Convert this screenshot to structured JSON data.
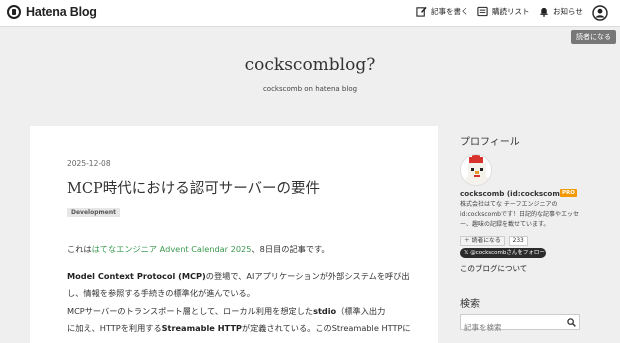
{
  "topbar": {
    "logo": "Hatena Blog",
    "write": "記事を書く",
    "reading_list": "購読リスト",
    "notifications": "お知らせ"
  },
  "reader_button": "読者になる",
  "blog": {
    "title": "cockscomblog?",
    "description": "cockscomb on hatena blog"
  },
  "article": {
    "date": "2025-12-08",
    "title": "MCP時代における認可サーバーの要件",
    "tag": "Development",
    "intro_prefix": "これは",
    "intro_link": "はてなエンジニア Advent Calendar 2025",
    "intro_suffix": "、8日目の記事です。",
    "p2_bold": "Model Context Protocol (MCP)",
    "p2_line1": "の登場で、AIアプリケーションが外部システムを呼び出",
    "p2_line2": "し、情報を参照する手続きの標準化が進んでいる。",
    "p3_a": "MCPサーバーのトランスポート層として、ローカル利用を想定した",
    "p3_b1": "stdio",
    "p3_c": "（標準入出力",
    "p3_d": "に加え、HTTPを利用する",
    "p3_b2": "Streamable HTTP",
    "p3_e": "が定義されている。このStreamable HTTPに"
  },
  "sidebar": {
    "profile_heading": "プロフィール",
    "name": "cockscomb (id:cockscomb)",
    "pro_badge": "PRO",
    "bio": "株式会社はてな チーフエンジニアのid:cockscombです！日記的な記事やエッセー、趣味の記録を載せています。",
    "follow_label": "読者になる",
    "follow_count": "233",
    "share_label": "@cockscombさんをフォロー",
    "about": "このブログについて",
    "search_heading": "検索",
    "search_placeholder": "記事を検索"
  },
  "colors": {
    "link": "#3a9a4f",
    "pro": "#f39800"
  }
}
